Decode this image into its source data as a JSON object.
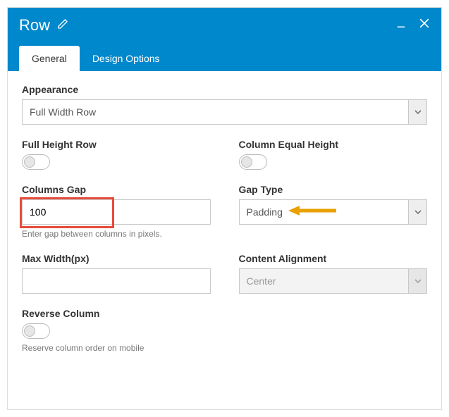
{
  "header": {
    "title": "Row"
  },
  "tabs": {
    "general": "General",
    "design": "Design Options"
  },
  "appearance": {
    "label": "Appearance",
    "value": "Full Width Row"
  },
  "fullHeight": {
    "label": "Full Height Row"
  },
  "equalHeight": {
    "label": "Column Equal Height"
  },
  "columnsGap": {
    "label": "Columns Gap",
    "value": "100",
    "helper": "Enter gap between columns in pixels."
  },
  "gapType": {
    "label": "Gap Type",
    "value": "Padding"
  },
  "maxWidth": {
    "label": "Max Width(px)",
    "value": ""
  },
  "contentAlign": {
    "label": "Content Alignment",
    "value": "Center"
  },
  "reverse": {
    "label": "Reverse Column",
    "helper": "Reserve column order on mobile"
  }
}
